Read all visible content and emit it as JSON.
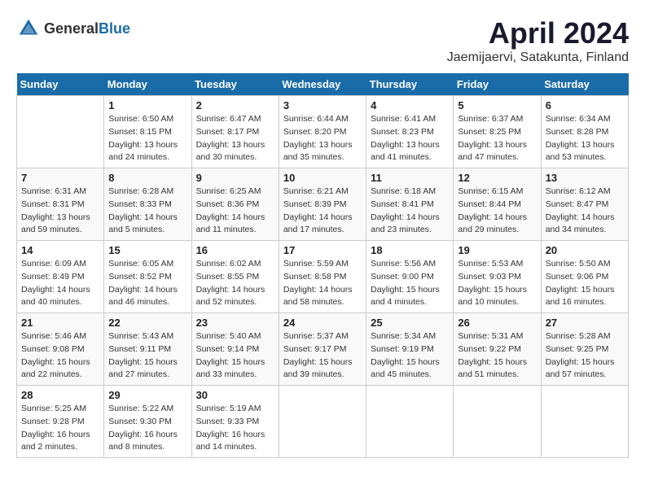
{
  "header": {
    "logo_general": "General",
    "logo_blue": "Blue",
    "title": "April 2024",
    "subtitle": "Jaemijaervi, Satakunta, Finland"
  },
  "calendar": {
    "days_of_week": [
      "Sunday",
      "Monday",
      "Tuesday",
      "Wednesday",
      "Thursday",
      "Friday",
      "Saturday"
    ],
    "weeks": [
      [
        {
          "day": "",
          "info": ""
        },
        {
          "day": "1",
          "info": "Sunrise: 6:50 AM\nSunset: 8:15 PM\nDaylight: 13 hours\nand 24 minutes."
        },
        {
          "day": "2",
          "info": "Sunrise: 6:47 AM\nSunset: 8:17 PM\nDaylight: 13 hours\nand 30 minutes."
        },
        {
          "day": "3",
          "info": "Sunrise: 6:44 AM\nSunset: 8:20 PM\nDaylight: 13 hours\nand 35 minutes."
        },
        {
          "day": "4",
          "info": "Sunrise: 6:41 AM\nSunset: 8:23 PM\nDaylight: 13 hours\nand 41 minutes."
        },
        {
          "day": "5",
          "info": "Sunrise: 6:37 AM\nSunset: 8:25 PM\nDaylight: 13 hours\nand 47 minutes."
        },
        {
          "day": "6",
          "info": "Sunrise: 6:34 AM\nSunset: 8:28 PM\nDaylight: 13 hours\nand 53 minutes."
        }
      ],
      [
        {
          "day": "7",
          "info": "Sunrise: 6:31 AM\nSunset: 8:31 PM\nDaylight: 13 hours\nand 59 minutes."
        },
        {
          "day": "8",
          "info": "Sunrise: 6:28 AM\nSunset: 8:33 PM\nDaylight: 14 hours\nand 5 minutes."
        },
        {
          "day": "9",
          "info": "Sunrise: 6:25 AM\nSunset: 8:36 PM\nDaylight: 14 hours\nand 11 minutes."
        },
        {
          "day": "10",
          "info": "Sunrise: 6:21 AM\nSunset: 8:39 PM\nDaylight: 14 hours\nand 17 minutes."
        },
        {
          "day": "11",
          "info": "Sunrise: 6:18 AM\nSunset: 8:41 PM\nDaylight: 14 hours\nand 23 minutes."
        },
        {
          "day": "12",
          "info": "Sunrise: 6:15 AM\nSunset: 8:44 PM\nDaylight: 14 hours\nand 29 minutes."
        },
        {
          "day": "13",
          "info": "Sunrise: 6:12 AM\nSunset: 8:47 PM\nDaylight: 14 hours\nand 34 minutes."
        }
      ],
      [
        {
          "day": "14",
          "info": "Sunrise: 6:09 AM\nSunset: 8:49 PM\nDaylight: 14 hours\nand 40 minutes."
        },
        {
          "day": "15",
          "info": "Sunrise: 6:05 AM\nSunset: 8:52 PM\nDaylight: 14 hours\nand 46 minutes."
        },
        {
          "day": "16",
          "info": "Sunrise: 6:02 AM\nSunset: 8:55 PM\nDaylight: 14 hours\nand 52 minutes."
        },
        {
          "day": "17",
          "info": "Sunrise: 5:59 AM\nSunset: 8:58 PM\nDaylight: 14 hours\nand 58 minutes."
        },
        {
          "day": "18",
          "info": "Sunrise: 5:56 AM\nSunset: 9:00 PM\nDaylight: 15 hours\nand 4 minutes."
        },
        {
          "day": "19",
          "info": "Sunrise: 5:53 AM\nSunset: 9:03 PM\nDaylight: 15 hours\nand 10 minutes."
        },
        {
          "day": "20",
          "info": "Sunrise: 5:50 AM\nSunset: 9:06 PM\nDaylight: 15 hours\nand 16 minutes."
        }
      ],
      [
        {
          "day": "21",
          "info": "Sunrise: 5:46 AM\nSunset: 9:08 PM\nDaylight: 15 hours\nand 22 minutes."
        },
        {
          "day": "22",
          "info": "Sunrise: 5:43 AM\nSunset: 9:11 PM\nDaylight: 15 hours\nand 27 minutes."
        },
        {
          "day": "23",
          "info": "Sunrise: 5:40 AM\nSunset: 9:14 PM\nDaylight: 15 hours\nand 33 minutes."
        },
        {
          "day": "24",
          "info": "Sunrise: 5:37 AM\nSunset: 9:17 PM\nDaylight: 15 hours\nand 39 minutes."
        },
        {
          "day": "25",
          "info": "Sunrise: 5:34 AM\nSunset: 9:19 PM\nDaylight: 15 hours\nand 45 minutes."
        },
        {
          "day": "26",
          "info": "Sunrise: 5:31 AM\nSunset: 9:22 PM\nDaylight: 15 hours\nand 51 minutes."
        },
        {
          "day": "27",
          "info": "Sunrise: 5:28 AM\nSunset: 9:25 PM\nDaylight: 15 hours\nand 57 minutes."
        }
      ],
      [
        {
          "day": "28",
          "info": "Sunrise: 5:25 AM\nSunset: 9:28 PM\nDaylight: 16 hours\nand 2 minutes."
        },
        {
          "day": "29",
          "info": "Sunrise: 5:22 AM\nSunset: 9:30 PM\nDaylight: 16 hours\nand 8 minutes."
        },
        {
          "day": "30",
          "info": "Sunrise: 5:19 AM\nSunset: 9:33 PM\nDaylight: 16 hours\nand 14 minutes."
        },
        {
          "day": "",
          "info": ""
        },
        {
          "day": "",
          "info": ""
        },
        {
          "day": "",
          "info": ""
        },
        {
          "day": "",
          "info": ""
        }
      ]
    ]
  }
}
